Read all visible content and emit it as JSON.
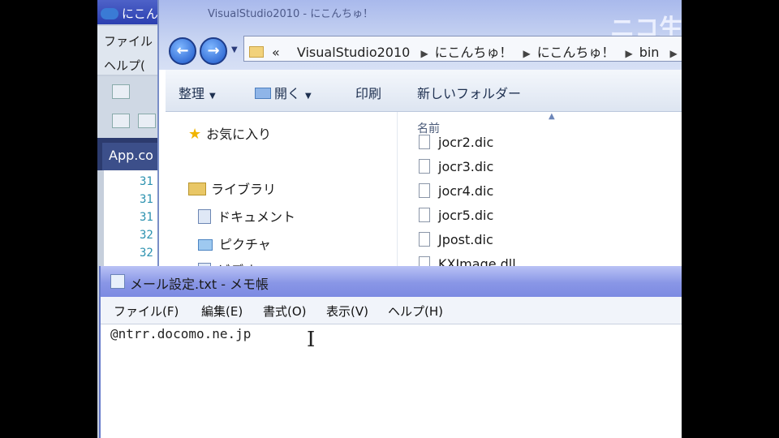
{
  "vs": {
    "title": "にこん",
    "menu": [
      "ファイル",
      "ヘルプ("
    ],
    "tab": "App.co",
    "line_numbers": [
      "31",
      "31",
      "31",
      "32",
      "32"
    ]
  },
  "explorer": {
    "title": "VisualStudio2010 - にこんちゅ！",
    "logo": "ニコ生",
    "address": {
      "prefix": "«",
      "crumbs": [
        "VisualStudio2010",
        "にこんちゅ！",
        "にこんちゅ！",
        "bin"
      ]
    },
    "commands": {
      "organize": "整理",
      "open": "開く",
      "print": "印刷",
      "new_folder": "新しいフォルダー"
    },
    "nav": {
      "favorites": "お気に入り",
      "libraries": "ライブラリ",
      "documents": "ドキュメント",
      "pictures": "ピクチャ",
      "video": "ビデオ"
    },
    "files_header": "名前",
    "files": [
      "jocr2.dic",
      "jocr3.dic",
      "jocr4.dic",
      "jocr5.dic",
      "Jpost.dic",
      "KXImage.dll"
    ]
  },
  "notepad": {
    "title": "メール設定.txt - メモ帳",
    "menu": [
      "ファイル(F)",
      "編集(E)",
      "書式(O)",
      "表示(V)",
      "ヘルプ(H)"
    ],
    "content": "@ntrr.docomo.ne.jp"
  }
}
